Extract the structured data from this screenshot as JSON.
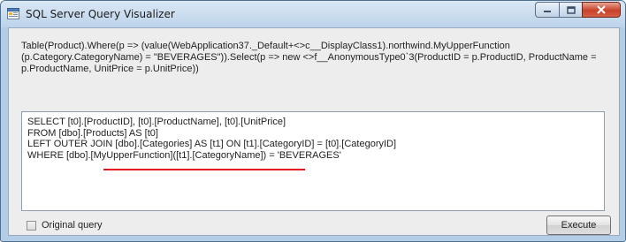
{
  "window": {
    "title": "SQL Server Query Visualizer"
  },
  "expression": {
    "text": "Table(Product).Where(p => (value(WebApplication37._Default+<>c__DisplayClass1).northwind.MyUpperFunction (p.Category.CategoryName) = \"BEVERAGES\")).Select(p => new <>f__AnonymousType0`3(ProductID = p.ProductID, ProductName = p.ProductName, UnitPrice = p.UnitPrice))"
  },
  "sql": {
    "lines": [
      "SELECT [t0].[ProductID], [t0].[ProductName], [t0].[UnitPrice]",
      "FROM [dbo].[Products] AS [t0]",
      "LEFT OUTER JOIN [dbo].[Categories] AS [t1] ON [t1].[CategoryID] = [t0].[CategoryID]",
      "WHERE [dbo].[MyUpperFunction]([t1].[CategoryName]) = 'BEVERAGES'"
    ],
    "highlight_color": "#e0141c"
  },
  "options": {
    "original_query_label": "Original query",
    "original_query_checked": false
  },
  "actions": {
    "execute_label": "Execute"
  },
  "icons": {
    "app": "app-window-icon",
    "minimize": "minimize-icon",
    "maximize": "maximize-icon",
    "close": "close-icon"
  }
}
